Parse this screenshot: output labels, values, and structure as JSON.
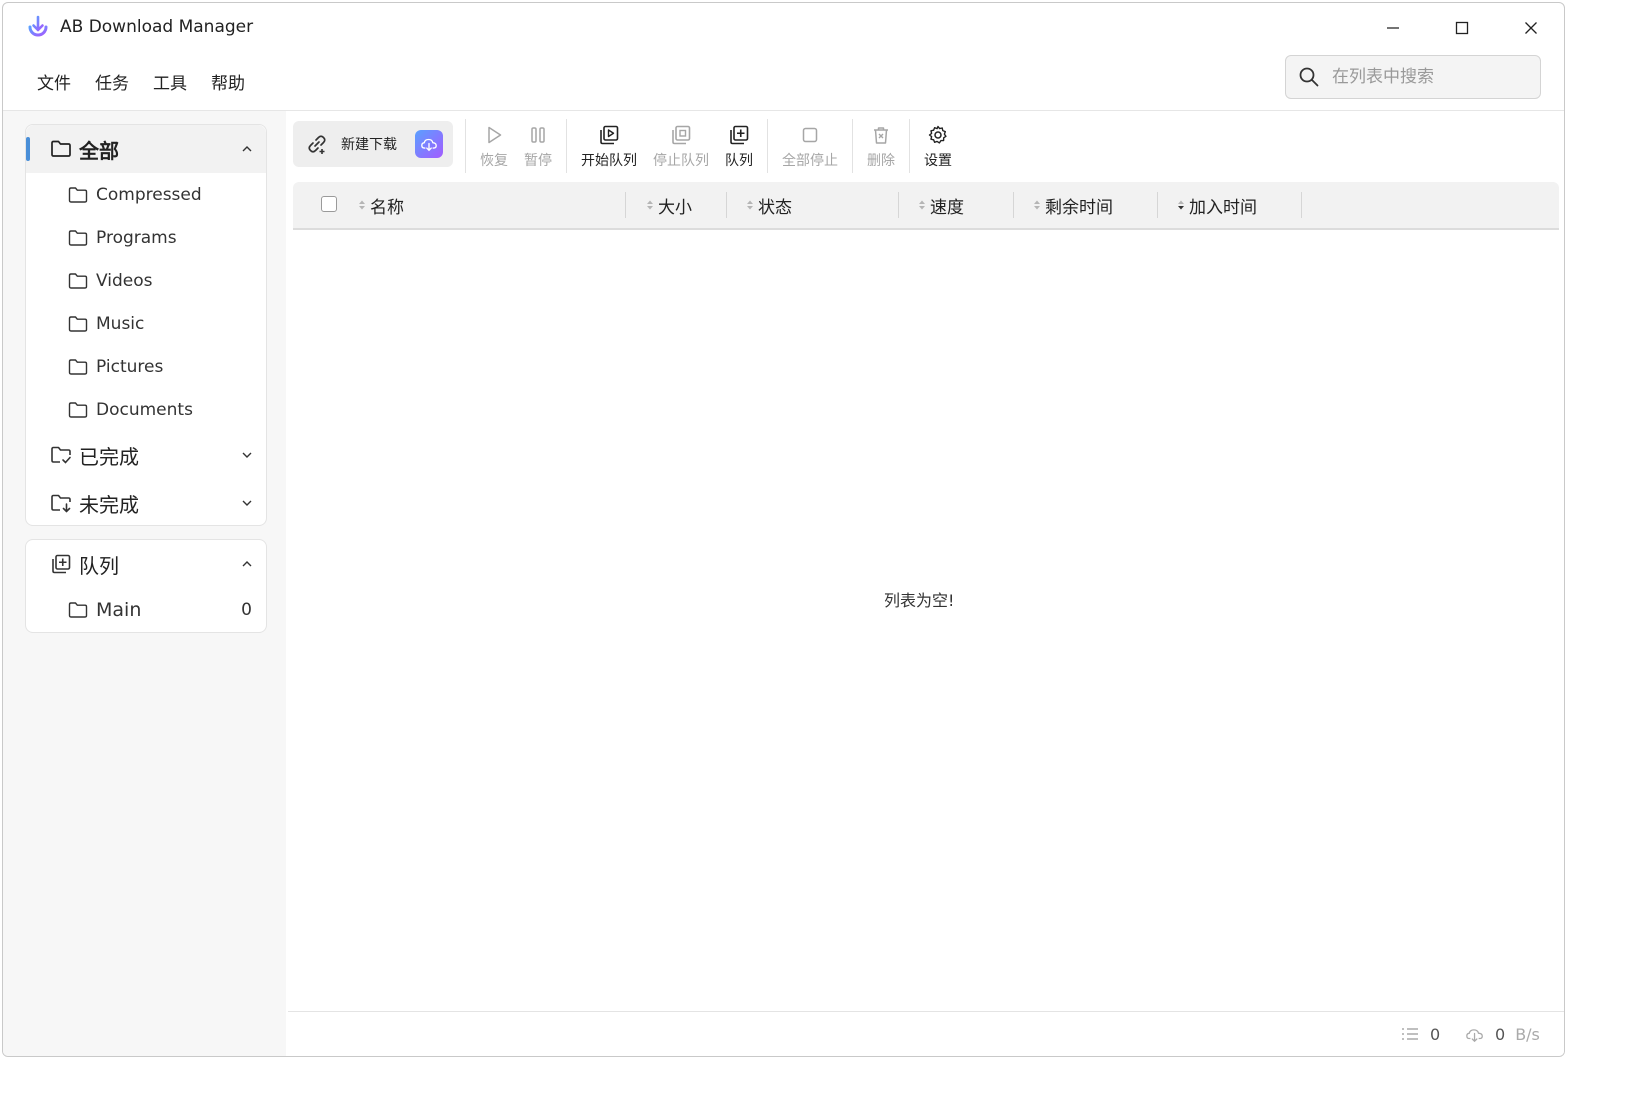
{
  "app": {
    "title": "AB Download Manager",
    "brand_color": "#7b5cff",
    "accent": "#4a8fd8"
  },
  "menu": [
    "文件",
    "任务",
    "工具",
    "帮助"
  ],
  "search": {
    "placeholder": "在列表中搜索",
    "value": ""
  },
  "sidebar": {
    "categories": {
      "label": "全部",
      "expanded": true,
      "items": [
        {
          "label": "Compressed"
        },
        {
          "label": "Programs"
        },
        {
          "label": "Videos"
        },
        {
          "label": "Music"
        },
        {
          "label": "Pictures"
        },
        {
          "label": "Documents"
        }
      ]
    },
    "completed": {
      "label": "已完成"
    },
    "unfinished": {
      "label": "未完成"
    },
    "queues": {
      "label": "队列",
      "items": [
        {
          "label": "Main",
          "count": "0"
        }
      ]
    }
  },
  "toolbar": {
    "new_download": "新建下载",
    "resume": "恢复",
    "pause": "暂停",
    "start_queue": "开始队列",
    "stop_queue": "停止队列",
    "queue": "队列",
    "stop_all": "全部停止",
    "delete": "删除",
    "settings": "设置"
  },
  "table": {
    "columns": [
      "名称",
      "大小",
      "状态",
      "速度",
      "剩余时间",
      "加入时间"
    ],
    "rows": [],
    "empty_message": "列表为空!"
  },
  "status_bar": {
    "active_count": "0",
    "speed_value": "0",
    "speed_unit": "B/s"
  }
}
